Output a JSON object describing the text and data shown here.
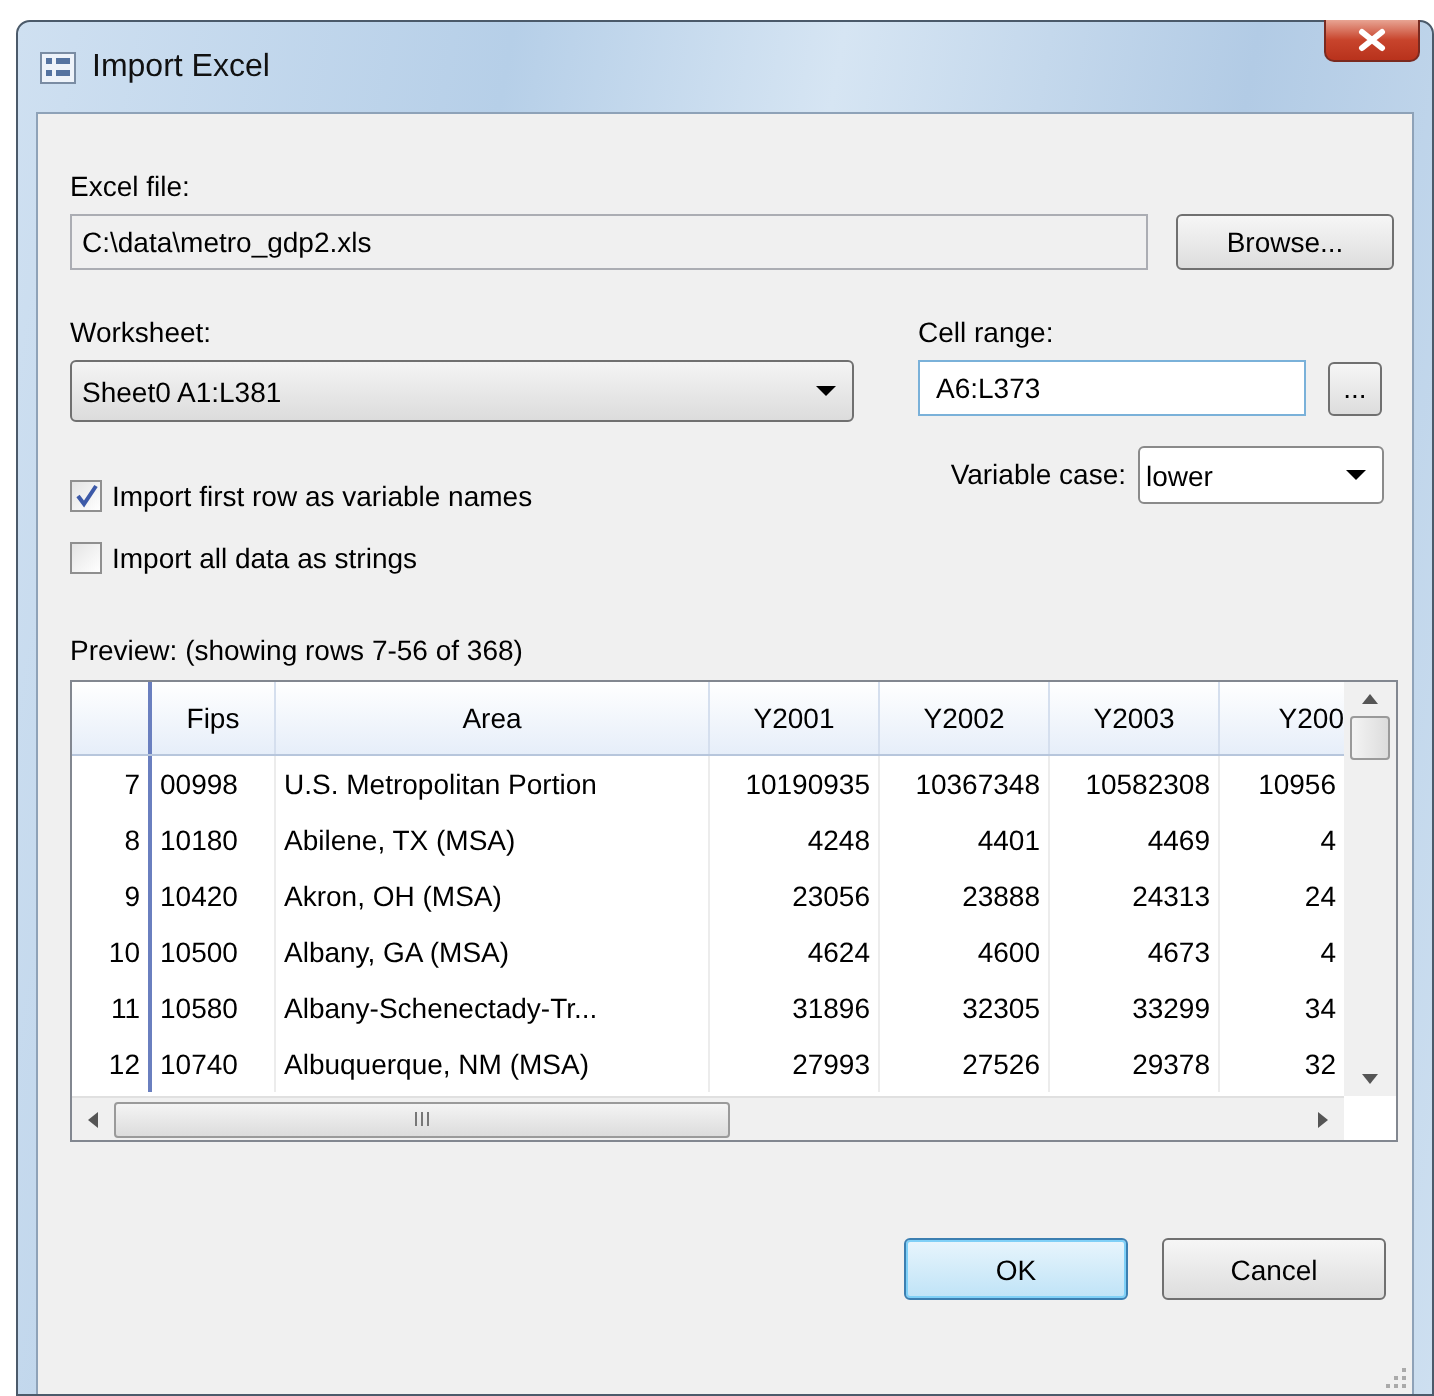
{
  "window": {
    "title": "Import Excel"
  },
  "excel_file": {
    "label": "Excel file:",
    "value": "C:\\data\\metro_gdp2.xls",
    "button": "Browse..."
  },
  "worksheet": {
    "label": "Worksheet:",
    "value": "Sheet0 A1:L381"
  },
  "cell_range": {
    "label": "Cell range:",
    "value": "A6:L373",
    "button": "..."
  },
  "options": [
    {
      "label": "Import first row as variable names",
      "checked": true
    },
    {
      "label": "Import all data as strings",
      "checked": false
    }
  ],
  "variable_case": {
    "label": "Variable case:",
    "value": "lower"
  },
  "preview": {
    "label": "Preview: (showing rows 7-56 of 368)",
    "columns": [
      "Fips",
      "Area",
      "Y2001",
      "Y2002",
      "Y2003",
      "Y200"
    ],
    "rows": [
      {
        "number": "7",
        "cells": [
          "00998",
          "U.S. Metropolitan Portion",
          "10190935",
          "10367348",
          "10582308",
          "10956"
        ]
      },
      {
        "number": "8",
        "cells": [
          "10180",
          "Abilene, TX (MSA)",
          "4248",
          "4401",
          "4469",
          "4"
        ]
      },
      {
        "number": "9",
        "cells": [
          "10420",
          "Akron, OH (MSA)",
          "23056",
          "23888",
          "24313",
          "24"
        ]
      },
      {
        "number": "10",
        "cells": [
          "10500",
          "Albany, GA (MSA)",
          "4624",
          "4600",
          "4673",
          "4"
        ]
      },
      {
        "number": "11",
        "cells": [
          "10580",
          "Albany-Schenectady-Tr...",
          "31896",
          "32305",
          "33299",
          "34"
        ]
      },
      {
        "number": "12",
        "cells": [
          "10740",
          "Albuquerque, NM (MSA)",
          "27993",
          "27526",
          "29378",
          "32"
        ]
      }
    ]
  },
  "buttons": [
    {
      "label": "OK",
      "default": true
    },
    {
      "label": "Cancel",
      "default": false
    }
  ]
}
